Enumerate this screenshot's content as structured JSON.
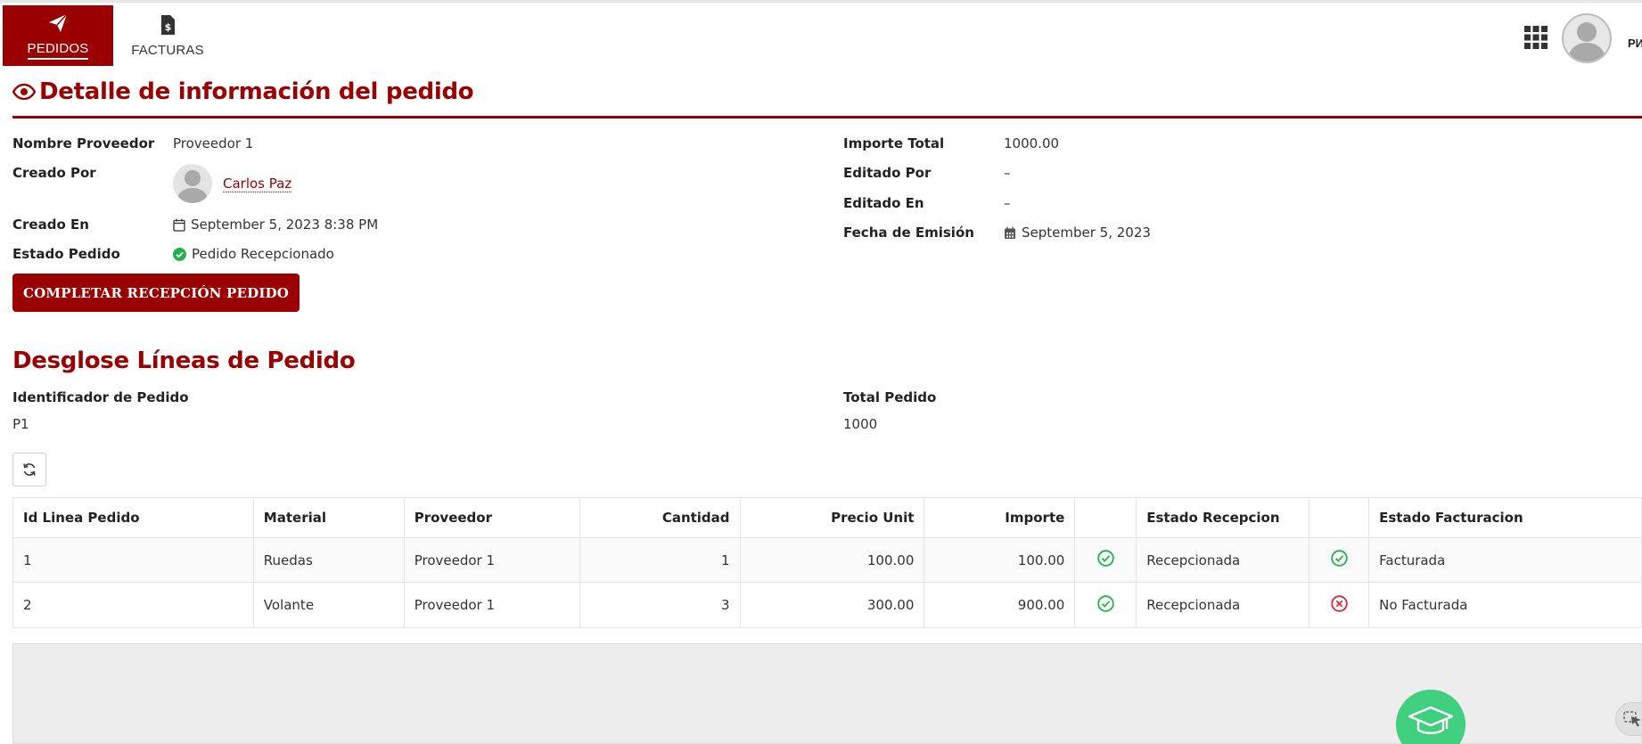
{
  "nav": {
    "items": [
      {
        "label": "PEDIDOS",
        "icon": "paper-plane-icon",
        "active": true
      },
      {
        "label": "FACTURAS",
        "icon": "invoice-icon",
        "active": false
      }
    ],
    "user_short": "РИ",
    "accent": "#9b0000"
  },
  "page": {
    "title": "Detalle de información del pedido"
  },
  "details": {
    "left": {
      "proveedor_label": "Nombre Proveedor",
      "proveedor_value": "Proveedor 1",
      "creado_por_label": "Creado Por",
      "creado_por_value": "Carlos Paz",
      "creado_en_label": "Creado En",
      "creado_en_value": "September 5, 2023 8:38 PM",
      "estado_label": "Estado Pedido",
      "estado_value": "Pedido Recepcionado"
    },
    "right": {
      "importe_label": "Importe Total",
      "importe_value": "1000.00",
      "editado_por_label": "Editado Por",
      "editado_por_value": "–",
      "editado_en_label": "Editado En",
      "editado_en_value": "–",
      "fecha_label": "Fecha de Emisión",
      "fecha_value": "September 5, 2023"
    }
  },
  "actions": {
    "complete_label": "COMPLETAR RECEPCIÓN PEDIDO"
  },
  "breakdown": {
    "title": "Desglose Líneas de Pedido",
    "id_label": "Identificador de Pedido",
    "id_value": "P1",
    "total_label": "Total Pedido",
    "total_value": "1000"
  },
  "table": {
    "headers": [
      "Id Linea Pedido",
      "Material",
      "Proveedor",
      "Cantidad",
      "Precio Unit",
      "Importe",
      "",
      "Estado Recepcion",
      "",
      "Estado Facturacion"
    ],
    "rows": [
      {
        "id": "1",
        "material": "Ruedas",
        "proveedor": "Proveedor 1",
        "cantidad": "1",
        "precio": "100.00",
        "importe": "100.00",
        "recepcion_icon": "check-circle-icon",
        "recepcion": "Recepcionada",
        "facturacion_icon": "check-circle-icon",
        "facturacion": "Facturada"
      },
      {
        "id": "2",
        "material": "Volante",
        "proveedor": "Proveedor 1",
        "cantidad": "3",
        "precio": "300.00",
        "importe": "900.00",
        "recepcion_icon": "check-circle-icon",
        "recepcion": "Recepcionada",
        "facturacion_icon": "x-circle-icon",
        "facturacion": "No Facturada"
      }
    ]
  },
  "colors": {
    "accent": "#9b0000",
    "success": "#22b14c",
    "danger": "#d7263d",
    "fab": "#3fcf7e"
  }
}
